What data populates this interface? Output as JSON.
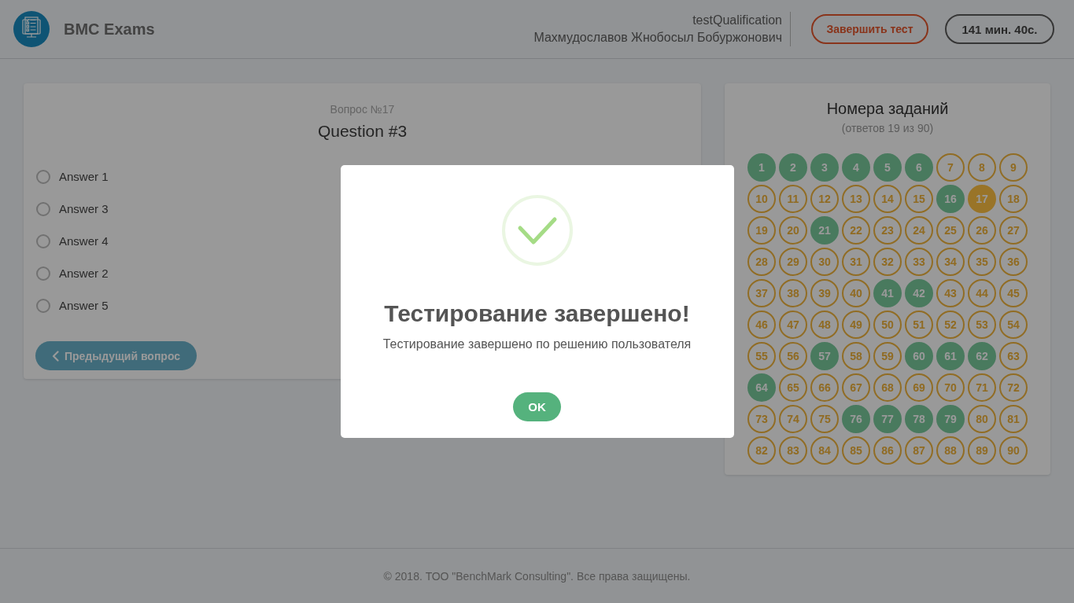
{
  "header": {
    "brand": "BMC Exams",
    "test_name": "testQualification",
    "full_name": "Махмудославов Жнобосыл Бобуржонович",
    "finish_button": "Завершить тест",
    "timer": "141 мин. 40с."
  },
  "question": {
    "number_label": "Вопрос №17",
    "title": "Question #3",
    "answers": [
      {
        "label": "Answer 1",
        "selected": false
      },
      {
        "label": "Answer 3",
        "selected": false
      },
      {
        "label": "Answer 4",
        "selected": false
      },
      {
        "label": "Answer 2",
        "selected": false
      },
      {
        "label": "Answer 5",
        "selected": false
      }
    ],
    "prev_button": "Предыдущий вопрос"
  },
  "navigator": {
    "title": "Номера заданий",
    "subtitle": "(ответов 19 из 90)",
    "questions": [
      {
        "label": "1",
        "answered": true,
        "selected": false
      },
      {
        "label": "2",
        "answered": true,
        "selected": false
      },
      {
        "label": "3",
        "answered": true,
        "selected": false
      },
      {
        "label": "4",
        "answered": true,
        "selected": false
      },
      {
        "label": "5",
        "answered": true,
        "selected": false
      },
      {
        "label": "6",
        "answered": true,
        "selected": false
      },
      {
        "label": "7",
        "answered": false,
        "selected": false
      },
      {
        "label": "8",
        "answered": false,
        "selected": false
      },
      {
        "label": "9",
        "answered": false,
        "selected": false
      },
      {
        "label": "10",
        "answered": false,
        "selected": false
      },
      {
        "label": "11",
        "answered": false,
        "selected": false
      },
      {
        "label": "12",
        "answered": false,
        "selected": false
      },
      {
        "label": "13",
        "answered": false,
        "selected": false
      },
      {
        "label": "14",
        "answered": false,
        "selected": false
      },
      {
        "label": "15",
        "answered": false,
        "selected": false
      },
      {
        "label": "16",
        "answered": true,
        "selected": false
      },
      {
        "label": "17",
        "answered": false,
        "selected": true
      },
      {
        "label": "18",
        "answered": false,
        "selected": false
      },
      {
        "label": "19",
        "answered": false,
        "selected": false
      },
      {
        "label": "20",
        "answered": false,
        "selected": false
      },
      {
        "label": "21",
        "answered": true,
        "selected": false
      },
      {
        "label": "22",
        "answered": false,
        "selected": false
      },
      {
        "label": "23",
        "answered": false,
        "selected": false
      },
      {
        "label": "24",
        "answered": false,
        "selected": false
      },
      {
        "label": "25",
        "answered": false,
        "selected": false
      },
      {
        "label": "26",
        "answered": false,
        "selected": false
      },
      {
        "label": "27",
        "answered": false,
        "selected": false
      },
      {
        "label": "28",
        "answered": false,
        "selected": false
      },
      {
        "label": "29",
        "answered": false,
        "selected": false
      },
      {
        "label": "30",
        "answered": false,
        "selected": false
      },
      {
        "label": "31",
        "answered": false,
        "selected": false
      },
      {
        "label": "32",
        "answered": false,
        "selected": false
      },
      {
        "label": "33",
        "answered": false,
        "selected": false
      },
      {
        "label": "34",
        "answered": false,
        "selected": false
      },
      {
        "label": "35",
        "answered": false,
        "selected": false
      },
      {
        "label": "36",
        "answered": false,
        "selected": false
      },
      {
        "label": "37",
        "answered": false,
        "selected": false
      },
      {
        "label": "38",
        "answered": false,
        "selected": false
      },
      {
        "label": "39",
        "answered": false,
        "selected": false
      },
      {
        "label": "40",
        "answered": false,
        "selected": false
      },
      {
        "label": "41",
        "answered": true,
        "selected": false
      },
      {
        "label": "42",
        "answered": true,
        "selected": false
      },
      {
        "label": "43",
        "answered": false,
        "selected": false
      },
      {
        "label": "44",
        "answered": false,
        "selected": false
      },
      {
        "label": "45",
        "answered": false,
        "selected": false
      },
      {
        "label": "46",
        "answered": false,
        "selected": false
      },
      {
        "label": "47",
        "answered": false,
        "selected": false
      },
      {
        "label": "48",
        "answered": false,
        "selected": false
      },
      {
        "label": "49",
        "answered": false,
        "selected": false
      },
      {
        "label": "50",
        "answered": false,
        "selected": false
      },
      {
        "label": "51",
        "answered": false,
        "selected": false
      },
      {
        "label": "52",
        "answered": false,
        "selected": false
      },
      {
        "label": "53",
        "answered": false,
        "selected": false
      },
      {
        "label": "54",
        "answered": false,
        "selected": false
      },
      {
        "label": "55",
        "answered": false,
        "selected": false
      },
      {
        "label": "56",
        "answered": false,
        "selected": false
      },
      {
        "label": "57",
        "answered": true,
        "selected": false
      },
      {
        "label": "58",
        "answered": false,
        "selected": false
      },
      {
        "label": "59",
        "answered": false,
        "selected": false
      },
      {
        "label": "60",
        "answered": true,
        "selected": false
      },
      {
        "label": "61",
        "answered": true,
        "selected": false
      },
      {
        "label": "62",
        "answered": true,
        "selected": false
      },
      {
        "label": "63",
        "answered": false,
        "selected": false
      },
      {
        "label": "64",
        "answered": true,
        "selected": false
      },
      {
        "label": "65",
        "answered": false,
        "selected": false
      },
      {
        "label": "66",
        "answered": false,
        "selected": false
      },
      {
        "label": "67",
        "answered": false,
        "selected": false
      },
      {
        "label": "68",
        "answered": false,
        "selected": false
      },
      {
        "label": "69",
        "answered": false,
        "selected": false
      },
      {
        "label": "70",
        "answered": false,
        "selected": false
      },
      {
        "label": "71",
        "answered": false,
        "selected": false
      },
      {
        "label": "72",
        "answered": false,
        "selected": false
      },
      {
        "label": "73",
        "answered": false,
        "selected": false
      },
      {
        "label": "74",
        "answered": false,
        "selected": false
      },
      {
        "label": "75",
        "answered": false,
        "selected": false
      },
      {
        "label": "76",
        "answered": true,
        "selected": false
      },
      {
        "label": "77",
        "answered": true,
        "selected": false
      },
      {
        "label": "78",
        "answered": true,
        "selected": false
      },
      {
        "label": "79",
        "answered": true,
        "selected": false
      },
      {
        "label": "80",
        "answered": false,
        "selected": false
      },
      {
        "label": "81",
        "answered": false,
        "selected": false
      },
      {
        "label": "82",
        "answered": false,
        "selected": false
      },
      {
        "label": "83",
        "answered": false,
        "selected": false
      },
      {
        "label": "84",
        "answered": false,
        "selected": false
      },
      {
        "label": "85",
        "answered": false,
        "selected": false
      },
      {
        "label": "86",
        "answered": false,
        "selected": false
      },
      {
        "label": "87",
        "answered": false,
        "selected": false
      },
      {
        "label": "88",
        "answered": false,
        "selected": false
      },
      {
        "label": "89",
        "answered": false,
        "selected": false
      },
      {
        "label": "90",
        "answered": false,
        "selected": false
      }
    ]
  },
  "footer": {
    "copyright": "© 2018. ТОО \"BenchMark Consulting\". Все права защищены."
  },
  "modal": {
    "title": "Тестирование завершено!",
    "message": "Тестирование завершено по решению пользователя",
    "ok_button": "OK"
  }
}
